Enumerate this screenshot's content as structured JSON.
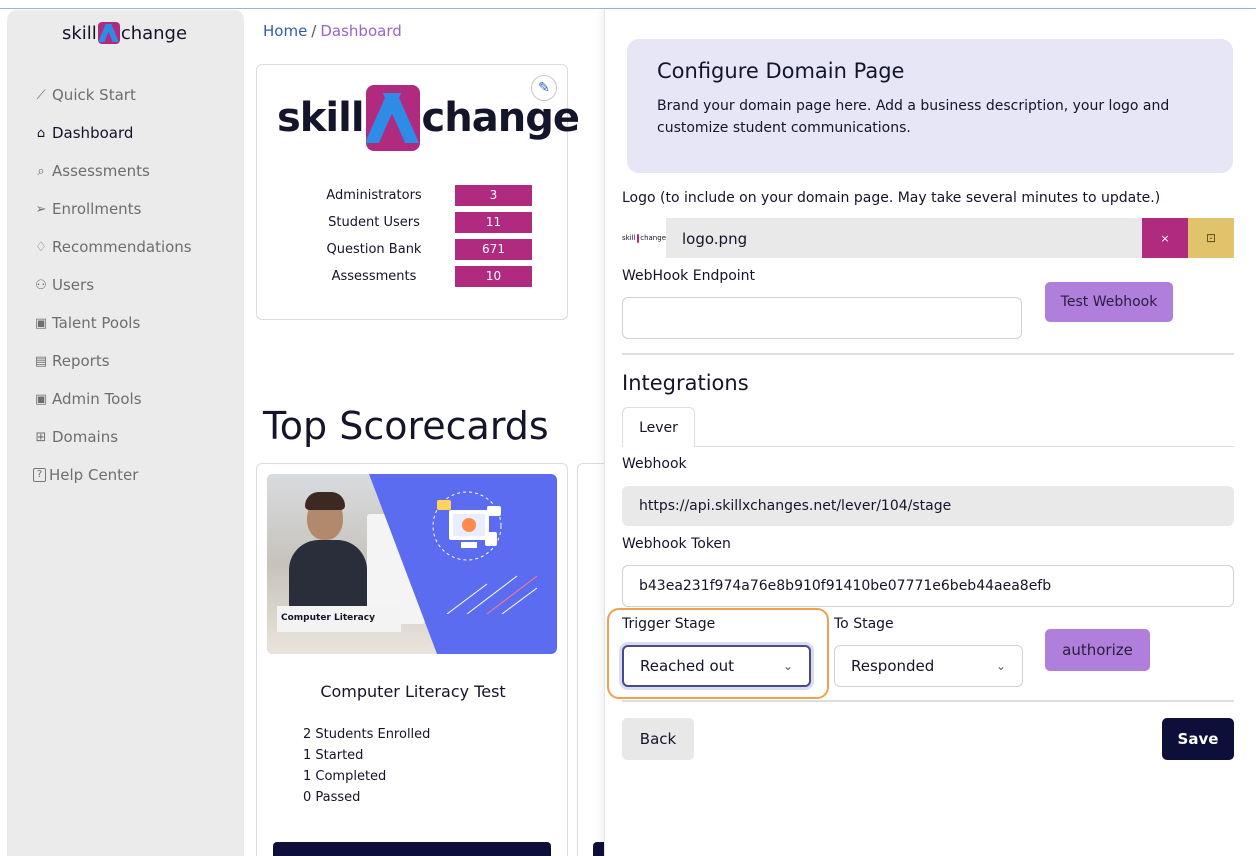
{
  "sidebar": {
    "brand_left": "skill",
    "brand_right": "change",
    "items": [
      {
        "icon": "chart-line-icon",
        "glyph": "⟋",
        "label": "Quick Start"
      },
      {
        "icon": "home-icon",
        "glyph": "⌂",
        "label": "Dashboard"
      },
      {
        "icon": "search-icon",
        "glyph": "⌕",
        "label": "Assessments"
      },
      {
        "icon": "send-icon",
        "glyph": "➢",
        "label": "Enrollments"
      },
      {
        "icon": "lightbulb-icon",
        "glyph": "♢",
        "label": "Recommendations"
      },
      {
        "icon": "users-icon",
        "glyph": "⚇",
        "label": "Users"
      },
      {
        "icon": "person-card-icon",
        "glyph": "▣",
        "label": "Talent Pools"
      },
      {
        "icon": "report-icon",
        "glyph": "▤",
        "label": "Reports"
      },
      {
        "icon": "admin-tools-icon",
        "glyph": "▣",
        "label": "Admin Tools"
      },
      {
        "icon": "grid-icon",
        "glyph": "⊞",
        "label": "Domains"
      },
      {
        "icon": "help-icon",
        "glyph": "?",
        "label": "Help Center"
      }
    ]
  },
  "breadcrumb": {
    "home": "Home",
    "sep": "/",
    "current": "Dashboard"
  },
  "stats_card": {
    "logo_left": "skill",
    "logo_right": "change",
    "rows": [
      {
        "label": "Administrators",
        "value": "3"
      },
      {
        "label": "Student Users",
        "value": "11"
      },
      {
        "label": "Question Bank",
        "value": "671"
      },
      {
        "label": "Assessments",
        "value": "10"
      }
    ]
  },
  "scorecards": {
    "heading": "Top Scorecards",
    "card1": {
      "thumb_label": "Computer Literacy",
      "title": "Computer Literacy Test",
      "stats": [
        "2 Students Enrolled",
        "1 Started",
        "1 Completed",
        "0 Passed"
      ]
    }
  },
  "panel": {
    "title": "Configure Domain Page",
    "description": "Brand your domain page here. Add a business description, your logo and customize student communications.",
    "logo_label": "Logo (to include on your domain page. May take several minutes to update.)",
    "mini_logo_left": "skill",
    "mini_logo_right": "change",
    "logo_file": "logo.png",
    "clear_glyph": "×",
    "browse_glyph": "⊡",
    "webhook_endpoint_label": "WebHook Endpoint",
    "webhook_endpoint_value": "",
    "test_webhook": "Test Webhook",
    "integrations_title": "Integrations",
    "tab_lever": "Lever",
    "webhook_label": "Webhook",
    "webhook_value": "https://api.skillxchanges.net/lever/104/stage",
    "token_label": "Webhook Token",
    "token_value": "b43ea231f974a76e8b910f91410be07771e6beb44aea8efb",
    "trigger_label": "Trigger Stage",
    "trigger_value": "Reached out",
    "to_label": "To Stage",
    "to_value": "Responded",
    "authorize": "authorize",
    "back": "Back",
    "save": "Save"
  },
  "colors": {
    "brand_magenta": "#b02b7f",
    "brand_blue": "#2f8ce6",
    "navy": "#0e0e3a",
    "lavender": "#e6e6f6",
    "purple_button": "#b07fdb",
    "focus_orange": "#f0a050"
  }
}
